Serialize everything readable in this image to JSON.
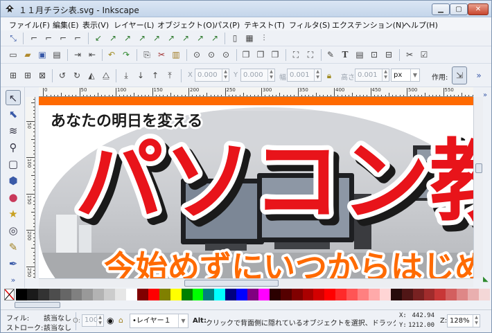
{
  "window": {
    "title": "１１月チラシ表.svg - Inkscape",
    "min_label": "▁",
    "max_label": "▢",
    "close_label": "✕"
  },
  "menu": [
    "ファイル(F)",
    "編集(E)",
    "表示(V)",
    "レイヤー(L)",
    "オブジェクト(O)",
    "パス(P)",
    "テキスト(T)",
    "フィルタ(S)",
    "エクステンション(N)",
    "ヘルプ(H)"
  ],
  "toolbar_controls": {
    "x_label": "X",
    "x_value": "0.000",
    "y_label": "Y",
    "y_value": "0.000",
    "w_label": "幅",
    "w_value": "0.001",
    "h_label": "高さ",
    "h_value": "0.001",
    "unit": "px",
    "affect_label": "作用:",
    "more": "»"
  },
  "rulers": {
    "top_numbers": [
      "0",
      "50",
      "100",
      "150",
      "200",
      "250",
      "300",
      "350",
      "400",
      "450",
      "500",
      "550",
      "600"
    ],
    "left_numbers": [
      "50",
      "100",
      "150",
      "200",
      "250",
      "300",
      "350"
    ]
  },
  "artwork": {
    "tagline": "あなたの明日を変える",
    "headline": "パソコン教",
    "subline": "今始めずにいつからはじめ"
  },
  "palette": {
    "colors": [
      "#000000",
      "#1a1a1a",
      "#333333",
      "#4d4d4d",
      "#666666",
      "#808080",
      "#999999",
      "#b3b3b3",
      "#cccccc",
      "#e6e6e6",
      "#ffffff",
      "#800000",
      "#ff0000",
      "#808000",
      "#ffff00",
      "#008000",
      "#00ff00",
      "#008080",
      "#00ffff",
      "#000080",
      "#0000ff",
      "#800080",
      "#ff00ff",
      "#2b0000",
      "#550000",
      "#800000",
      "#aa0000",
      "#d40000",
      "#ff0000",
      "#ff2a2a",
      "#ff5555",
      "#ff8080",
      "#ffaaaa",
      "#ffd5d5",
      "#280b0b",
      "#501616",
      "#782121",
      "#a02c2c",
      "#c83737",
      "#d35f5f",
      "#de8787",
      "#e9afaf",
      "#f4d7d7"
    ]
  },
  "status": {
    "fill_label": "フィル:",
    "fill_value": "該当なし",
    "stroke_label": "ストローク:",
    "stroke_value": "該当なし",
    "opacity_label": "O:",
    "opacity_value": "100",
    "layer": "•レイヤー１",
    "message_bold": "Alt:",
    "message": " クリックで背面側に隠れているオブジェクトを選択、ドラッグ",
    "x_label": "X:",
    "x_value": "442.94",
    "y_label": "Y:",
    "y_value": "1212.00",
    "zoom_label": "Z:",
    "zoom_value": "128%"
  }
}
